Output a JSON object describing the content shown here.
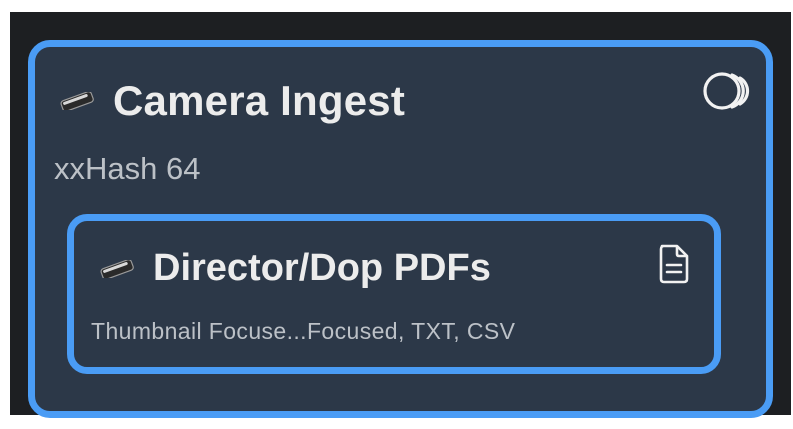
{
  "outer_card": {
    "title": "Camera Ingest",
    "subtitle": "xxHash 64",
    "icon": "drive-icon",
    "status_icon": "sync-rings-icon"
  },
  "inner_card": {
    "title": "Director/Dop PDFs",
    "subtitle": "Thumbnail Focuse...Focused, TXT, CSV",
    "icon": "drive-icon",
    "status_icon": "document-icon"
  },
  "colors": {
    "accent": "#4a9cf5",
    "card_bg": "#2c3848",
    "window_bg": "#1d1f22",
    "title_text": "#ececec",
    "subtitle_text": "#bcc1c7"
  }
}
